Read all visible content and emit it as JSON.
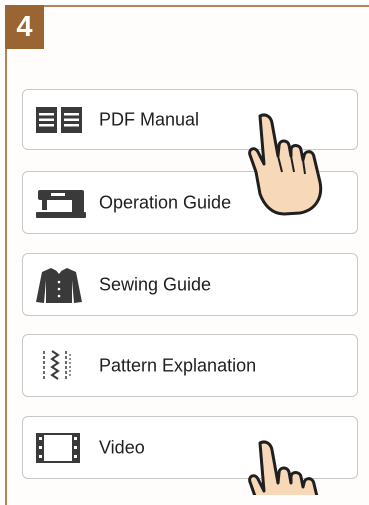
{
  "step": {
    "number": "4"
  },
  "colors": {
    "badge": "#9b6433",
    "frame": "#b58356",
    "button_border": "#c8c8c8"
  },
  "menu": {
    "items": [
      {
        "label": "PDF Manual",
        "icon": "book-icon"
      },
      {
        "label": "Operation Guide",
        "icon": "sewing-machine-icon"
      },
      {
        "label": "Sewing Guide",
        "icon": "jacket-icon"
      },
      {
        "label": "Pattern Explanation",
        "icon": "stitch-pattern-icon"
      },
      {
        "label": "Video",
        "icon": "film-icon"
      }
    ]
  },
  "hints": [
    "tap-hand-icon",
    "tap-hand-icon"
  ]
}
